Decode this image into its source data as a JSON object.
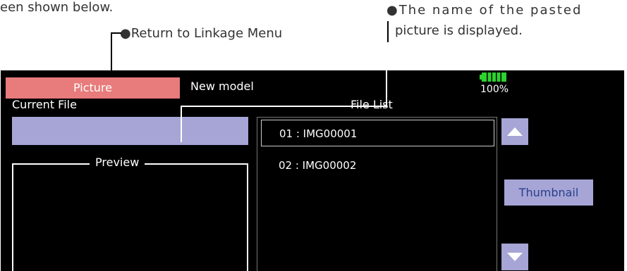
{
  "header_text": "een shown below.",
  "annotations": {
    "return_to_linkage": "Return to Linkage Menu",
    "pasted_picture_line1": "The name of the pasted",
    "pasted_picture_line2": "picture is displayed."
  },
  "screen": {
    "tab_label": "Picture",
    "model_name": "New model",
    "battery_percent": "100%",
    "battery_level": 1.0,
    "current_file_label": "Current File",
    "current_file_value": "",
    "preview_label": "Preview",
    "file_list_label": "File List",
    "files": [
      {
        "label": "01 : IMG00001",
        "selected": true
      },
      {
        "label": "02 : IMG00002",
        "selected": false
      }
    ],
    "thumbnail_button": "Thumbnail",
    "colors": {
      "tab_active": "#e87b7b",
      "field_fill": "#a6a5d6",
      "battery_green": "#2fd12f"
    }
  }
}
